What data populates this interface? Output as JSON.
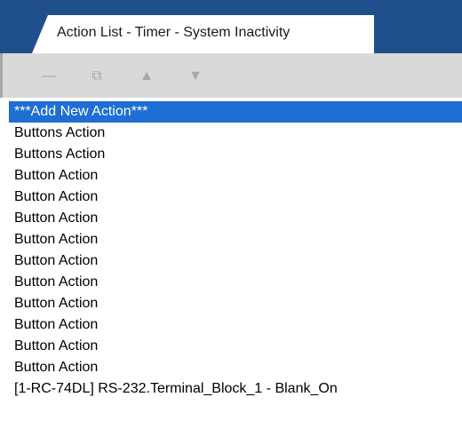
{
  "window": {
    "tab_title": "Action List - Timer - System Inactivity"
  },
  "toolbar": {
    "buttons": [
      {
        "icon": "minus-icon",
        "glyph": "—",
        "label": "Remove action"
      },
      {
        "icon": "copy-icon",
        "glyph": "⧉",
        "label": "Copy action"
      },
      {
        "icon": "arrow-up-icon",
        "glyph": "▲",
        "label": "Move up"
      },
      {
        "icon": "arrow-down-icon",
        "glyph": "▼",
        "label": "Move down"
      }
    ]
  },
  "colors": {
    "header_bg": "#1f4f8a",
    "toolbar_bg": "#d9d9d9",
    "selection_bg": "#1e6ed4",
    "disabled_icon": "#a8a8a8"
  },
  "actions": {
    "items": [
      {
        "label": "***Add New Action***",
        "selected": true
      },
      {
        "label": "Buttons Action",
        "selected": false
      },
      {
        "label": "Buttons Action",
        "selected": false
      },
      {
        "label": "Button Action",
        "selected": false
      },
      {
        "label": "Button Action",
        "selected": false
      },
      {
        "label": "Button Action",
        "selected": false
      },
      {
        "label": "Button Action",
        "selected": false
      },
      {
        "label": "Button Action",
        "selected": false
      },
      {
        "label": "Button Action",
        "selected": false
      },
      {
        "label": "Button Action",
        "selected": false
      },
      {
        "label": "Button Action",
        "selected": false
      },
      {
        "label": "Button Action",
        "selected": false
      },
      {
        "label": "Button Action",
        "selected": false
      },
      {
        "label": "[1-RC-74DL] RS-232.Terminal_Block_1 - Blank_On",
        "selected": false
      }
    ]
  }
}
